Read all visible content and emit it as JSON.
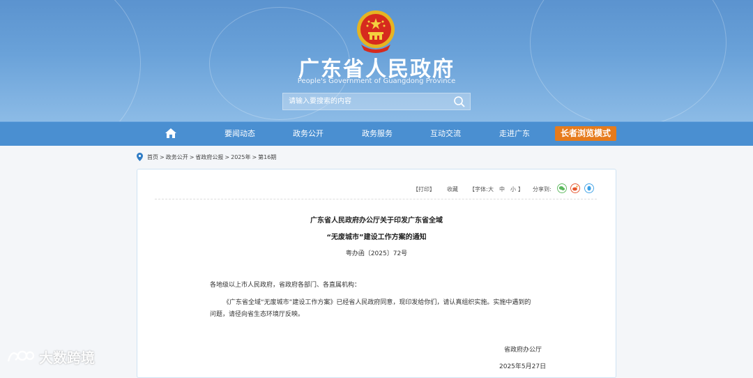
{
  "header": {
    "title": "广东省人民政府",
    "subtitle": "People's Government of Guangdong Province",
    "search_placeholder": "请输入要搜索的内容"
  },
  "nav": {
    "items": [
      "要闻动态",
      "政务公开",
      "政务服务",
      "互动交流",
      "走进广东"
    ],
    "elder_mode": "长者浏览模式"
  },
  "breadcrumb": [
    "首页",
    "政务公开",
    "省政府公报",
    "2025年",
    "第16期"
  ],
  "breadcrumb_sep": ">",
  "tools": {
    "print": "【打印】",
    "favorite": "收藏",
    "font_label": "【字体:",
    "font_large": "大",
    "font_medium": "中",
    "font_small": "小",
    "font_end": "】",
    "share": "分享到:"
  },
  "document": {
    "title_line1": "广东省人民政府办公厅关于印发广东省全域",
    "title_line2": "“无废城市”建设工作方案的通知",
    "doc_no": "粤办函〔2025〕72号",
    "salutation": "各地级以上市人民政府，省政府各部门、各直属机构：",
    "body_line1": "《广东省全域“无废城市”建设工作方案》已经省人民政府同意，现印发给你们，请认真组织实施。实施中遇到的",
    "body_line2": "问题，请径向省生态环境厅反映。",
    "signer": "省政府办公厅",
    "date": "2025年5月27日"
  },
  "watermark": "大数跨境",
  "colors": {
    "banner": "#5b93cf",
    "nav": "#4a8fd1",
    "elder_button": "#e67b1c",
    "panel_border": "#cfe3f3",
    "wechat": "#5bb85d",
    "weibo": "#e5542b",
    "qq": "#3aa0e6"
  }
}
